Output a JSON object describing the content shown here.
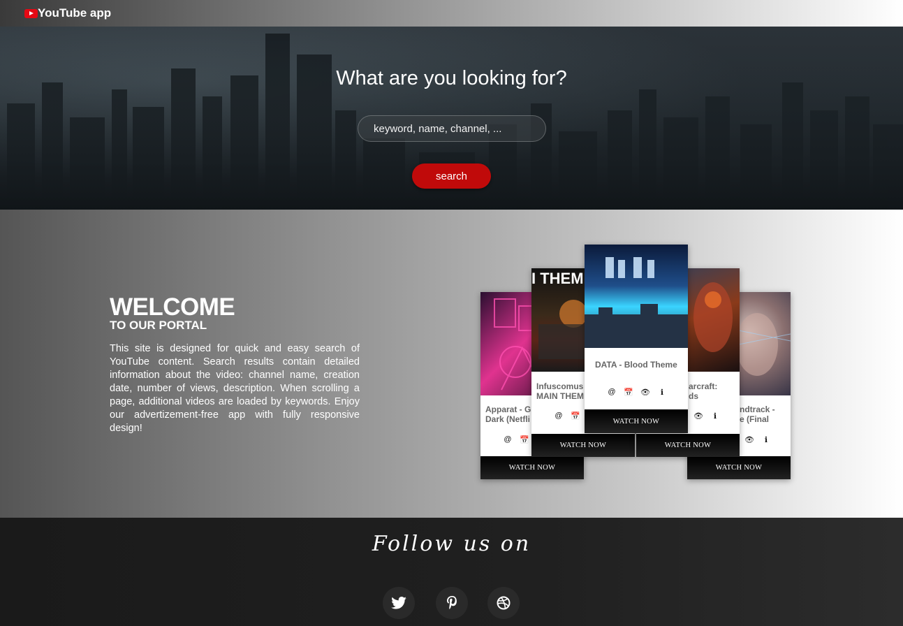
{
  "header": {
    "brand": "YouTube app",
    "logo_icon": "youtube-play-icon"
  },
  "hero": {
    "title": "What are you looking for?",
    "search_placeholder": "keyword, name, channel, ...",
    "search_button": "search"
  },
  "welcome": {
    "title": "WELCOME",
    "subtitle": "TO OUR PORTAL",
    "text": "This site is designed for quick and easy search of YouTube content. Search results contain detailed information about the video: channel name, creation date, number of views, description. When scrolling a page, additional videos are loaded by keywords. Enjoy our advertizement-free app with fully responsive design!"
  },
  "cards": [
    {
      "title": "Apparat - Goodbye (Dark (Netflix",
      "title_visible": "Apparat - G\nDark (Netfli",
      "thumb_text": "",
      "icons": [
        "at-icon",
        "calendar-icon"
      ],
      "watch": "WATCH NOW"
    },
    {
      "title": "Infuscomus - MAIN THEME",
      "title_visible": "Infuscomus\nMAIN THEM",
      "thumb_text": "I THEME",
      "icons": [
        "at-icon",
        "calendar-icon"
      ],
      "watch": "WATCH NOW"
    },
    {
      "title": "DATA - Blood Theme",
      "title_visible": "DATA - Blood Theme",
      "thumb_text": "",
      "icons": [
        "at-icon",
        "calendar-icon",
        "eye-icon",
        "info-icon"
      ],
      "watch": "WATCH NOW"
    },
    {
      "title": "arcraft: ds",
      "title_visible": "arcraft:\nds",
      "thumb_text": "",
      "icons": [
        "eye-icon",
        "info-icon"
      ],
      "watch": "WATCH NOW"
    },
    {
      "title": "ndtrack - e (Final",
      "title_visible": "ndtrack -\ne (Final",
      "thumb_text": "",
      "icons": [
        "eye-icon",
        "info-icon"
      ],
      "watch": "WATCH NOW"
    }
  ],
  "footer": {
    "follow": "Follow us on",
    "social": [
      "twitter-icon",
      "pinterest-icon",
      "dribbble-icon"
    ]
  },
  "colors": {
    "accent": "#c00a0a",
    "brand_red": "#e50914",
    "dark": "#1a1a1a"
  }
}
